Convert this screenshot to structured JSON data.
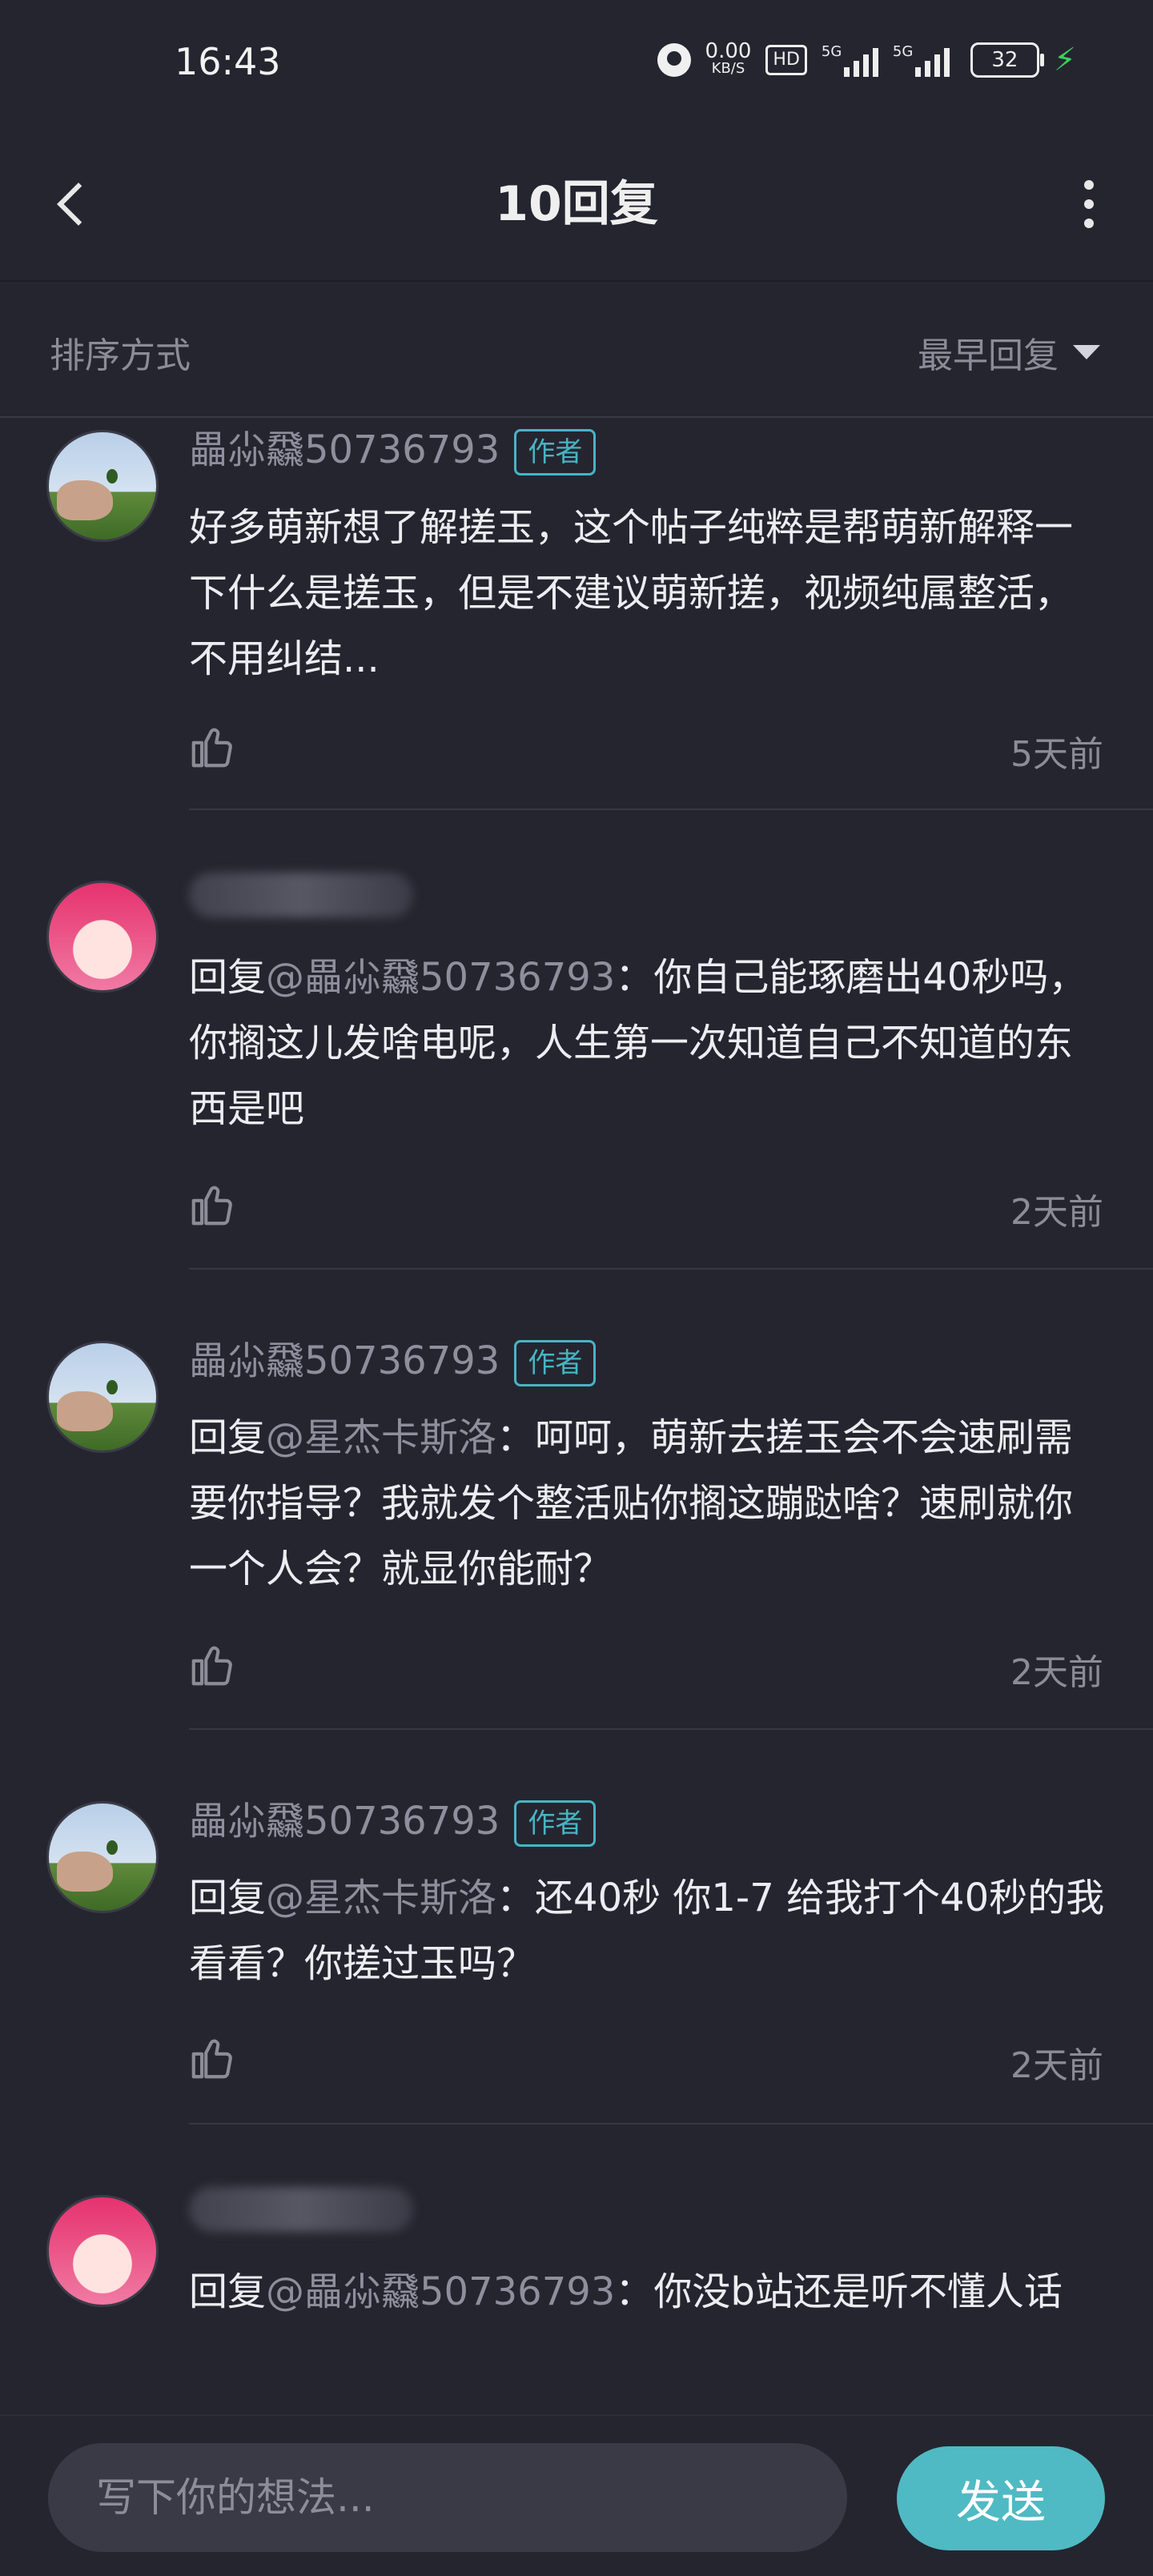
{
  "status_bar": {
    "time": "16:43",
    "net_speed": "0.00",
    "net_unit": "KB/S",
    "hd_label": "HD",
    "signal1_label": "5G",
    "signal2_label": "5G",
    "battery": "32"
  },
  "header": {
    "title": "10回复"
  },
  "sort": {
    "label": "排序方式",
    "current": "最早回复"
  },
  "comments": [
    {
      "username": "畾尛飝50736793",
      "badge": "作者",
      "reply_prefix": "",
      "mention": "",
      "text": "好多萌新想了解搓玉，这个帖子纯粹是帮萌新解释一下什么是搓玉，但是不建议萌新搓，视频纯属整活，不用纠结...",
      "time": "5天前"
    },
    {
      "username": "",
      "badge": "",
      "reply_prefix": "回复",
      "mention": "@畾尛飝50736793",
      "text": "：你自己能琢磨出40秒吗，你搁这儿发啥电呢，人生第一次知道自己不知道的东西是吧",
      "time": "2天前"
    },
    {
      "username": "畾尛飝50736793",
      "badge": "作者",
      "reply_prefix": "回复",
      "mention": "@星杰卡斯洛",
      "text": "：呵呵，萌新去搓玉会不会速刷需要你指导？我就发个整活贴你搁这蹦跶啥？速刷就你一个人会？就显你能耐？",
      "time": "2天前"
    },
    {
      "username": "畾尛飝50736793",
      "badge": "作者",
      "reply_prefix": "回复",
      "mention": "@星杰卡斯洛",
      "text": "：还40秒  你1-7 给我打个40秒的我看看？你搓过玉吗？",
      "time": "2天前"
    },
    {
      "username": "",
      "badge": "",
      "reply_prefix": "回复",
      "mention": "@畾尛飝50736793",
      "text": "：你没b站还是听不懂人话",
      "time": ""
    }
  ],
  "composer": {
    "placeholder": "写下你的想法...",
    "send_label": "发送"
  }
}
